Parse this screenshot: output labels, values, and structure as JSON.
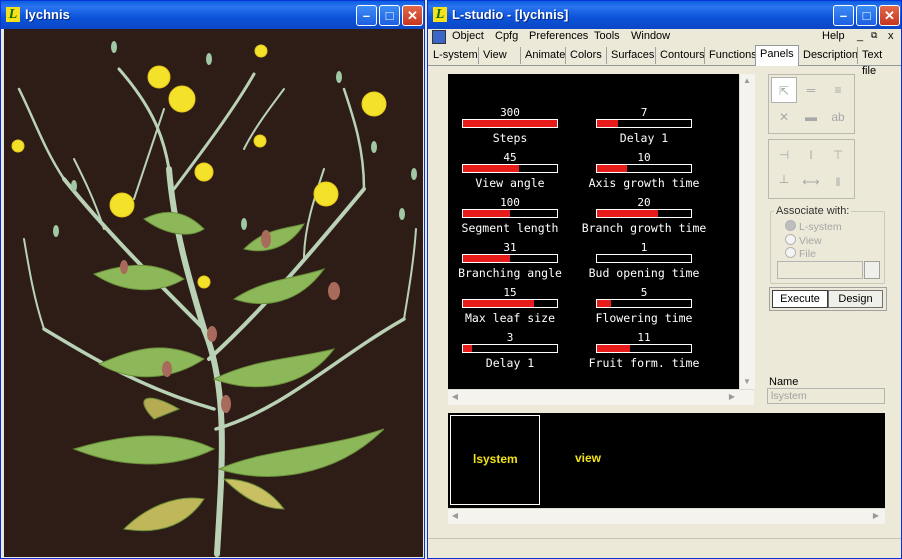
{
  "left_window": {
    "title": "lychnis",
    "logo": "L",
    "bg": "#2e1c17"
  },
  "right_window": {
    "title": "L-studio - [lychnis]",
    "logo": "L",
    "menu": [
      "Object",
      "Cpfg",
      "Preferences",
      "Tools",
      "Window"
    ],
    "menu_right": {
      "help": "Help",
      "min": "_",
      "restore": "⧉",
      "close": "x"
    },
    "tabs": [
      "L-system",
      "View",
      "Animate",
      "Colors",
      "Surfaces",
      "Contours",
      "Functions",
      "Panels",
      "Description",
      "Text file"
    ],
    "active_tab": "Panels"
  },
  "window_buttons": {
    "minimize": "–",
    "maximize": "□",
    "close": "✕"
  },
  "panel_controls": [
    {
      "label": "Steps",
      "value": "300",
      "fill": 1.0
    },
    {
      "label": "Delay 1",
      "value": "7",
      "fill": 0.22
    },
    {
      "label": "View angle",
      "value": "45",
      "fill": 0.6
    },
    {
      "label": "Axis growth time",
      "value": "10",
      "fill": 0.32
    },
    {
      "label": "Segment length",
      "value": "100",
      "fill": 0.5
    },
    {
      "label": "Branch growth time",
      "value": "20",
      "fill": 0.65
    },
    {
      "label": "Branching angle",
      "value": "31",
      "fill": 0.5
    },
    {
      "label": "Bud opening time",
      "value": "1",
      "fill": 0.0
    },
    {
      "label": "Max leaf size",
      "value": "15",
      "fill": 0.75
    },
    {
      "label": "Flowering time",
      "value": "5",
      "fill": 0.15
    },
    {
      "label": "Delay 1",
      "value": "3",
      "fill": 0.1
    },
    {
      "label": "Fruit form. time",
      "value": "11",
      "fill": 0.35
    }
  ],
  "colors": {
    "fill": "#e81b1b",
    "pane": "#000000",
    "item_text": "#f2e21a"
  },
  "tool_groups": {
    "group1": [
      "pointer-icon",
      "slider-icon",
      "menu-icon",
      "delete-icon",
      "button-icon",
      "label-icon"
    ],
    "group1_glyphs": [
      "⇱",
      "═",
      "≡",
      "✕",
      "▬",
      "ab"
    ],
    "group2": [
      "align-left-icon",
      "align-center-icon",
      "align-right-icon",
      "align-bottom-icon",
      "spread-h-icon",
      "spread-v-icon"
    ],
    "group2_glyphs": [
      "⊣",
      "I",
      "⊤",
      "┴",
      "⟷",
      "‖"
    ]
  },
  "associate": {
    "label": "Associate with:",
    "options": [
      "L-system",
      "View",
      "File"
    ]
  },
  "buttons": {
    "execute": "Execute",
    "design": "Design"
  },
  "name_field": {
    "label": "Name",
    "value": "lsystem"
  },
  "items": [
    "lsystem",
    "view"
  ]
}
